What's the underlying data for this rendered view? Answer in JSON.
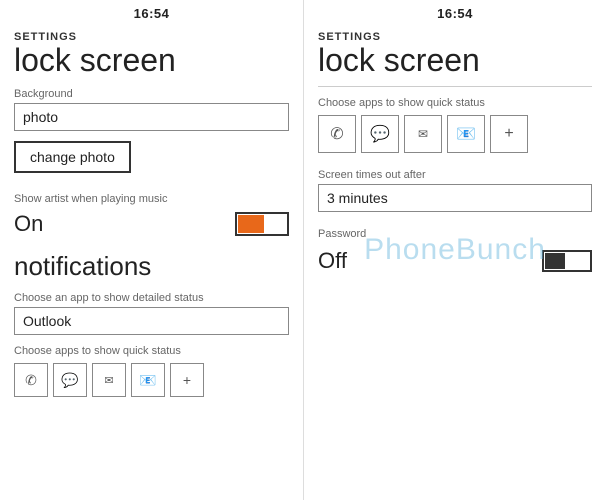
{
  "left_panel": {
    "status_time": "16:54",
    "settings_label": "SETTINGS",
    "page_title": "lock screen",
    "background_label": "Background",
    "background_value": "photo",
    "change_photo_label": "change photo",
    "music_label": "Show artist when playing music",
    "on_label": "On",
    "notifications_title": "notifications",
    "detailed_status_label": "Choose an app to show detailed status",
    "detailed_status_value": "Outlook",
    "quick_status_label": "Choose apps to show quick status",
    "quick_status_icons": [
      "✆",
      "💬",
      "✉",
      "📧",
      "+"
    ]
  },
  "right_panel": {
    "status_time": "16:54",
    "settings_label": "SETTINGS",
    "page_title": "lock screen",
    "quick_status_label": "Choose apps to show quick status",
    "quick_status_icons": [
      "✆",
      "💬",
      "✉",
      "📧",
      "+"
    ],
    "timeout_label": "Screen times out after",
    "timeout_value": "3 minutes",
    "password_label": "Password",
    "off_label": "Off"
  },
  "watermark": "PhoneBunch"
}
